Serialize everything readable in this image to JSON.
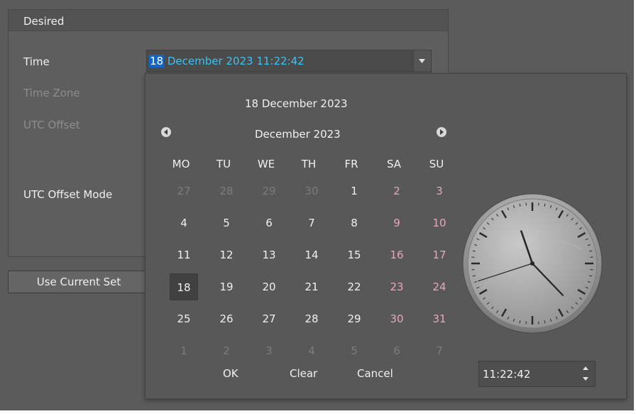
{
  "group": {
    "title": "Desired",
    "labels": {
      "time": "Time",
      "time_zone": "Time Zone",
      "utc_offset": "UTC Offset",
      "utc_offset_mode": "UTC Offset Mode"
    },
    "time_value_day": "18",
    "time_value_rest": " December 2023 11:22:42",
    "use_current_label": "Use Current Set"
  },
  "picker": {
    "selected_date": "18 December 2023",
    "month_label": "December 2023",
    "weekdays": [
      "MO",
      "TU",
      "WE",
      "TH",
      "FR",
      "SA",
      "SU"
    ],
    "weeks": [
      [
        "27",
        "28",
        "29",
        "30",
        "1",
        "2",
        "3"
      ],
      [
        "4",
        "5",
        "6",
        "7",
        "8",
        "9",
        "10"
      ],
      [
        "11",
        "12",
        "13",
        "14",
        "15",
        "16",
        "17"
      ],
      [
        "18",
        "19",
        "20",
        "21",
        "22",
        "23",
        "24"
      ],
      [
        "25",
        "26",
        "27",
        "28",
        "29",
        "30",
        "31"
      ],
      [
        "1",
        "2",
        "3",
        "4",
        "5",
        "6",
        "7"
      ]
    ],
    "ok_label": "OK",
    "clear_label": "Clear",
    "cancel_label": "Cancel",
    "time_spin_value": "11:22:42",
    "clock_time": {
      "hour": 11,
      "minute": 22,
      "second": 42
    }
  },
  "colors": {
    "background": "#5b5b5b",
    "accent_text": "#3cc1f0",
    "selection": "#1166c7",
    "weekend": "#e2a8c0"
  },
  "icons": {
    "combo_arrow": "chevron-down-icon",
    "prev_month": "arrow-left-circle-icon",
    "next_month": "arrow-right-circle-icon",
    "spin_up": "spin-up-icon",
    "spin_down": "spin-down-icon"
  }
}
